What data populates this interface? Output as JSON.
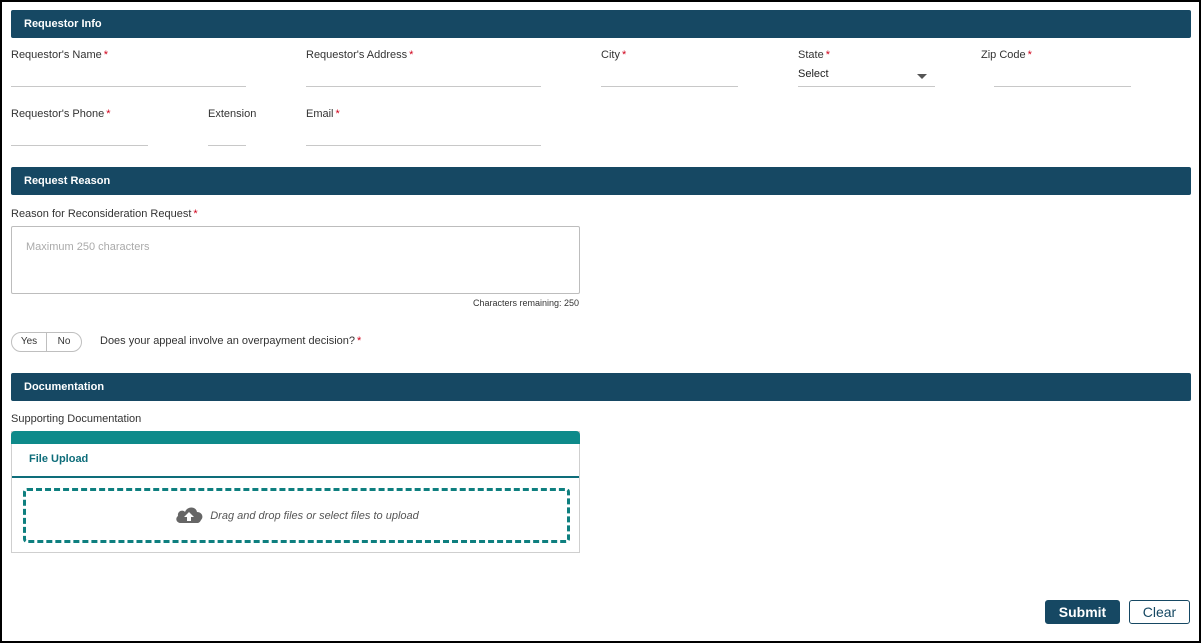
{
  "sections": {
    "requestor_info": "Requestor Info",
    "request_reason": "Request Reason",
    "documentation": "Documentation"
  },
  "requestor": {
    "name_label": "Requestor's Name",
    "address_label": "Requestor's Address",
    "city_label": "City",
    "state_label": "State",
    "state_value": "Select",
    "zip_label": "Zip Code",
    "phone_label": "Requestor's Phone",
    "extension_label": "Extension",
    "email_label": "Email",
    "required_mark": "*"
  },
  "reason": {
    "label": "Reason for Reconsideration Request",
    "placeholder": "Maximum 250 characters",
    "chars_remaining": "Characters remaining: 250"
  },
  "overpayment": {
    "yes_label": "Yes",
    "no_label": "No",
    "question": "Does your appeal involve an overpayment decision?"
  },
  "documentation": {
    "label": "Supporting Documentation",
    "tab_label": "File Upload",
    "drop_text": "Drag and drop files or select files to upload",
    "upload_icon": "cloud-upload-icon"
  },
  "actions": {
    "submit_label": "Submit",
    "clear_label": "Clear"
  },
  "colors": {
    "header": "#164863",
    "accent": "#0e8a8a",
    "required": "#d0021b"
  }
}
